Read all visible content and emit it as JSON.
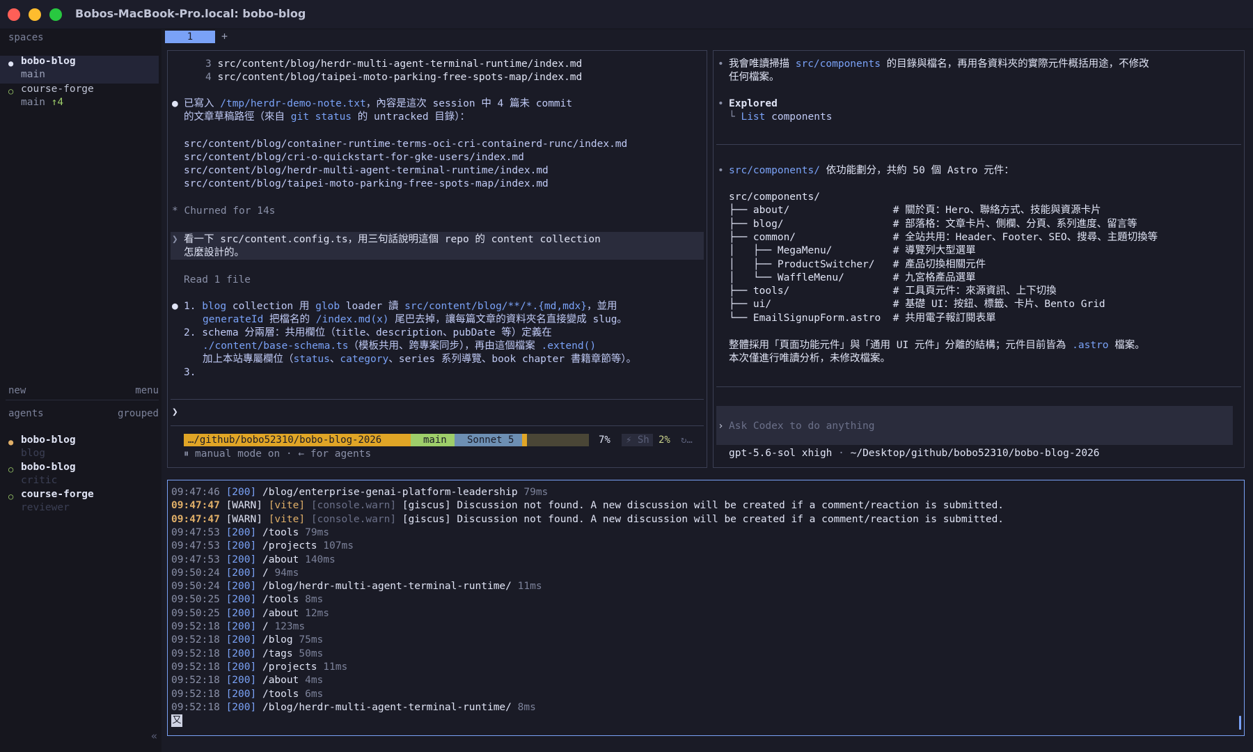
{
  "window": {
    "title": "Bobos-MacBook-Pro.local: bobo-blog"
  },
  "sidebar": {
    "spaces_header": "spaces",
    "spaces": [
      {
        "name": "bobo-blog",
        "branch": "main",
        "active": true,
        "dot": "●"
      },
      {
        "name": "course-forge",
        "branch": "main",
        "ahead": "↑4",
        "active": false,
        "dot": "○"
      }
    ],
    "new_label": "new",
    "menu_label": "menu",
    "agents_header": "agents",
    "grouped_label": "grouped",
    "agents": [
      {
        "name": "bobo-blog",
        "role": "blog",
        "dot": "●"
      },
      {
        "name": "bobo-blog",
        "role": "critic",
        "dot": "○"
      },
      {
        "name": "course-forge",
        "role": "reviewer",
        "dot": "○"
      }
    ],
    "collapse_glyph": "«"
  },
  "tabs": {
    "active": "1",
    "add": "+"
  },
  "left_pane": {
    "list_tail": [
      {
        "num": "3",
        "path": "src/content/blog/herdr-multi-agent-terminal-runtime/index.md"
      },
      {
        "num": "4",
        "path": "src/content/blog/taipei-moto-parking-free-spots-map/index.md"
      }
    ],
    "msg1": {
      "prefix": "已寫入 ",
      "file": "/tmp/herdr-demo-note.txt",
      "text1": "，內容是這次 session 中 4 篇未 commit",
      "line2a": "的文章草稿路徑（來自 ",
      "git": "git status",
      "line2b": " 的 untracked 目錄）："
    },
    "paths": [
      "src/content/blog/container-runtime-terms-oci-cri-containerd-runc/index.md",
      "src/content/blog/cri-o-quickstart-for-gke-users/index.md",
      "src/content/blog/herdr-multi-agent-terminal-runtime/index.md",
      "src/content/blog/taipei-moto-parking-free-spots-map/index.md"
    ],
    "churned": "* Churned for 14s",
    "prompt_line1": "看一下 src/content.config.ts，用三句話說明這個 repo 的 content collection",
    "prompt_line2": "怎麼設計的。",
    "read_file": "Read 1 file",
    "ans": {
      "l1a": "1. ",
      "l1b": "blog",
      "l1c": " collection 用 ",
      "l1d": "glob",
      "l1e": " loader 讀 ",
      "l1f": "src/content/blog/**/*.{md,mdx}",
      "l1g": "，並用",
      "l2a": "generateId",
      "l2b": " 把檔名的 ",
      "l2c": "/index.md(x)",
      "l2d": " 尾巴去掉，讓每篇文章的資料夾名直接變成 slug。",
      "l3": "2. schema 分兩層：共用欄位（title、description、pubDate 等）定義在",
      "l4a": "./content/base-schema.ts",
      "l4b": "（模板共用、跨專案同步），再由這個檔案 ",
      "l4c": ".extend()",
      "l5a": "加上本站專屬欄位（",
      "l5b": "status",
      "l5c": "、",
      "l5d": "category",
      "l5e": "、series 系列導覽、book chapter 書籍章節等）。",
      "l6": "3."
    },
    "input_prompt": "❯",
    "status": {
      "path": "…/github/bobo52310/bobo-blog-2026",
      "branch": "main",
      "model": "Sonnet 5",
      "context_pct": "7%",
      "sh": "⚡ Sh",
      "cost_pct": "2%",
      "spinner": "↻…",
      "context_fill": 0.07
    },
    "mode": "⏸ manual mode on · ← for agents"
  },
  "right_pane": {
    "l1a": "我會唯讀掃描 ",
    "l1b": "src/components",
    "l1c": " 的目錄與檔名，再用各資料夾的實際元件概括用途，不修改",
    "l2": "任何檔案。",
    "explored": "Explored",
    "explored_item_a": "└ ",
    "explored_item_b": "List",
    "explored_item_c": " components",
    "sum_a": "src/components/",
    "sum_b": " 依功能劃分，共約 50 個 Astro 元件：",
    "tree": [
      {
        "t": "src/components/",
        "c": ""
      },
      {
        "t": "├── about/                 ",
        "c": "# 關於頁：Hero、聯絡方式、技能與資源卡片"
      },
      {
        "t": "├── blog/                  ",
        "c": "# 部落格：文章卡片、側欄、分頁、系列進度、留言等"
      },
      {
        "t": "├── common/                ",
        "c": "# 全站共用：Header、Footer、SEO、搜尋、主題切換等"
      },
      {
        "t": "│   ├── MegaMenu/          ",
        "c": "# 導覽列大型選單"
      },
      {
        "t": "│   ├── ProductSwitcher/   ",
        "c": "# 產品切換相關元件"
      },
      {
        "t": "│   └── WaffleMenu/        ",
        "c": "# 九宮格產品選單"
      },
      {
        "t": "├── tools/                 ",
        "c": "# 工具頁元件：來源資訊、上下切換"
      },
      {
        "t": "├── ui/                    ",
        "c": "# 基礎 UI：按鈕、標籤、卡片、Bento Grid"
      },
      {
        "t": "└── EmailSignupForm.astro  ",
        "c": "# 共用電子報訂閱表單"
      }
    ],
    "close1a": "整體採用「頁面功能元件」與「通用 UI 元件」分離的結構；元件目前皆為 ",
    "close1b": ".astro",
    "close1c": " 檔案。",
    "close2": "本次僅進行唯讀分析，未修改檔案。",
    "input_placeholder": "Ask Codex to do anything",
    "footer_model": "gpt-5.6-sol xhigh",
    "footer_sep": " · ",
    "footer_path": "~/Desktop/github/bobo52310/bobo-blog-2026"
  },
  "log": {
    "entries": [
      {
        "ts": "09:47:46",
        "status": "[200]",
        "path": "/blog/enterprise-genai-platform-leadership",
        "ms": "79ms"
      },
      {
        "ts": "09:47:47",
        "warn": true,
        "level": "[WARN]",
        "tag": "[vite]",
        "src": "[console.warn]",
        "msg": "[giscus] Discussion not found. A new discussion will be created if a comment/reaction is submitted."
      },
      {
        "ts": "09:47:47",
        "warn": true,
        "level": "[WARN]",
        "tag": "[vite]",
        "src": "[console.warn]",
        "msg": "[giscus] Discussion not found. A new discussion will be created if a comment/reaction is submitted."
      },
      {
        "ts": "09:47:53",
        "status": "[200]",
        "path": "/tools",
        "ms": "79ms"
      },
      {
        "ts": "09:47:53",
        "status": "[200]",
        "path": "/projects",
        "ms": "107ms"
      },
      {
        "ts": "09:47:53",
        "status": "[200]",
        "path": "/about",
        "ms": "140ms"
      },
      {
        "ts": "09:50:24",
        "status": "[200]",
        "path": "/",
        "ms": "94ms"
      },
      {
        "ts": "09:50:24",
        "status": "[200]",
        "path": "/blog/herdr-multi-agent-terminal-runtime/",
        "ms": "11ms"
      },
      {
        "ts": "09:50:25",
        "status": "[200]",
        "path": "/tools",
        "ms": "8ms"
      },
      {
        "ts": "09:50:25",
        "status": "[200]",
        "path": "/about",
        "ms": "12ms"
      },
      {
        "ts": "09:52:18",
        "status": "[200]",
        "path": "/",
        "ms": "123ms"
      },
      {
        "ts": "09:52:18",
        "status": "[200]",
        "path": "/blog",
        "ms": "75ms"
      },
      {
        "ts": "09:52:18",
        "status": "[200]",
        "path": "/tags",
        "ms": "50ms"
      },
      {
        "ts": "09:52:18",
        "status": "[200]",
        "path": "/projects",
        "ms": "11ms"
      },
      {
        "ts": "09:52:18",
        "status": "[200]",
        "path": "/about",
        "ms": "4ms"
      },
      {
        "ts": "09:52:18",
        "status": "[200]",
        "path": "/tools",
        "ms": "6ms"
      },
      {
        "ts": "09:52:18",
        "status": "[200]",
        "path": "/blog/herdr-multi-agent-terminal-runtime/",
        "ms": "8ms"
      }
    ],
    "cursor": "又"
  },
  "colors": {
    "accent": "#7aa2f7",
    "status_path_bg": "#e0a526",
    "status_branch_bg": "#9ece6a",
    "status_model_bg": "#6d8fb3",
    "warn": "#e0af68"
  }
}
